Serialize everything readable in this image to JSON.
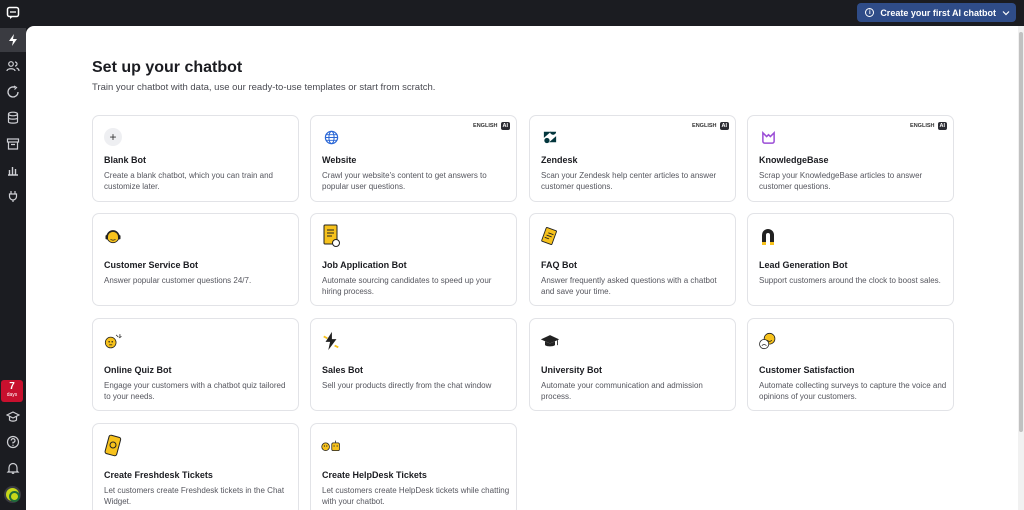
{
  "topbar": {
    "cta_label": "Create your first AI chatbot"
  },
  "sidebar": {
    "trial_days": "7",
    "trial_label": "days"
  },
  "page": {
    "title": "Set up your chatbot",
    "subtitle": "Train your chatbot with data, use our ready-to-use templates or start from scratch."
  },
  "badge": {
    "language": "ENGLISH",
    "ai": "AI"
  },
  "cards": [
    {
      "title": "Blank Bot",
      "desc": "Create a blank chatbot, which you can train and customize later."
    },
    {
      "title": "Website",
      "desc": "Crawl your website's content to get answers to popular user questions."
    },
    {
      "title": "Zendesk",
      "desc": "Scan your Zendesk help center articles to answer customer questions."
    },
    {
      "title": "KnowledgeBase",
      "desc": "Scrap your KnowledgeBase articles to answer customer questions."
    },
    {
      "title": "Customer Service Bot",
      "desc": "Answer popular customer questions 24/7."
    },
    {
      "title": "Job Application Bot",
      "desc": "Automate sourcing candidates to speed up your hiring process."
    },
    {
      "title": "FAQ Bot",
      "desc": "Answer frequently asked questions with a chatbot and save your time."
    },
    {
      "title": "Lead Generation Bot",
      "desc": "Support customers around the clock to boost sales."
    },
    {
      "title": "Online Quiz Bot",
      "desc": "Engage your customers with a chatbot quiz tailored to your needs."
    },
    {
      "title": "Sales Bot",
      "desc": "Sell your products directly from the chat window"
    },
    {
      "title": "University Bot",
      "desc": "Automate your communication and admission process."
    },
    {
      "title": "Customer Satisfaction",
      "desc": "Automate collecting surveys to capture the voice and opinions of your customers."
    },
    {
      "title": "Create Freshdesk Tickets",
      "desc": "Let customers create Freshdesk tickets in the Chat Widget."
    },
    {
      "title": "Create HelpDesk Tickets",
      "desc": "Let customers create HelpDesk tickets while chatting with your chatbot."
    }
  ]
}
